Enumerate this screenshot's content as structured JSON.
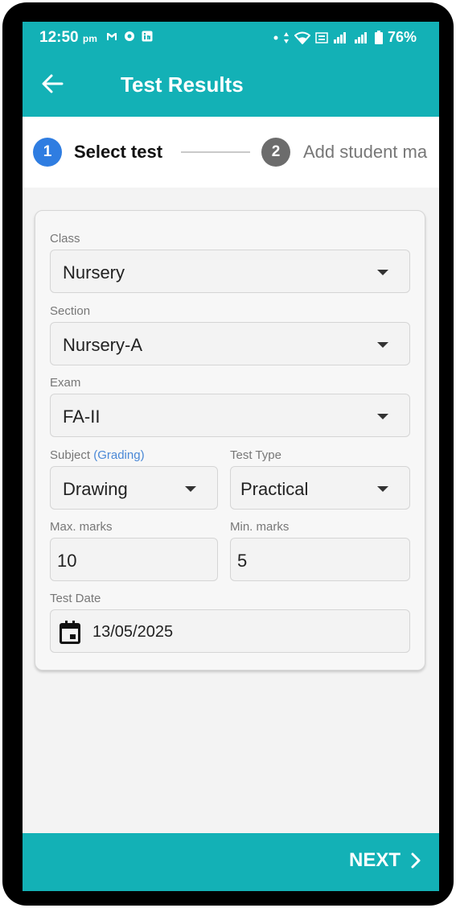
{
  "status_bar": {
    "time": "12:50",
    "ampm": "pm",
    "battery": "76%"
  },
  "app_bar": {
    "title": "Test Results"
  },
  "stepper": {
    "steps": [
      {
        "number": "1",
        "label": "Select test"
      },
      {
        "number": "2",
        "label": "Add student ma"
      }
    ]
  },
  "form": {
    "class": {
      "label": "Class",
      "value": "Nursery"
    },
    "section": {
      "label": "Section",
      "value": "Nursery-A"
    },
    "exam": {
      "label": "Exam",
      "value": "FA-II"
    },
    "subject": {
      "label": "Subject",
      "note": "(Grading)",
      "value": "Drawing"
    },
    "test_type": {
      "label": "Test Type",
      "value": "Practical"
    },
    "max_marks": {
      "label": "Max. marks",
      "value": "10"
    },
    "min_marks": {
      "label": "Min. marks",
      "value": "5"
    },
    "test_date": {
      "label": "Test Date",
      "value": "13/05/2025"
    }
  },
  "footer": {
    "next_label": "NEXT"
  },
  "colors": {
    "primary": "#13b1b6",
    "step_active": "#2f7de1",
    "step_inactive": "#6c6c6c",
    "link": "#4a88d6"
  }
}
